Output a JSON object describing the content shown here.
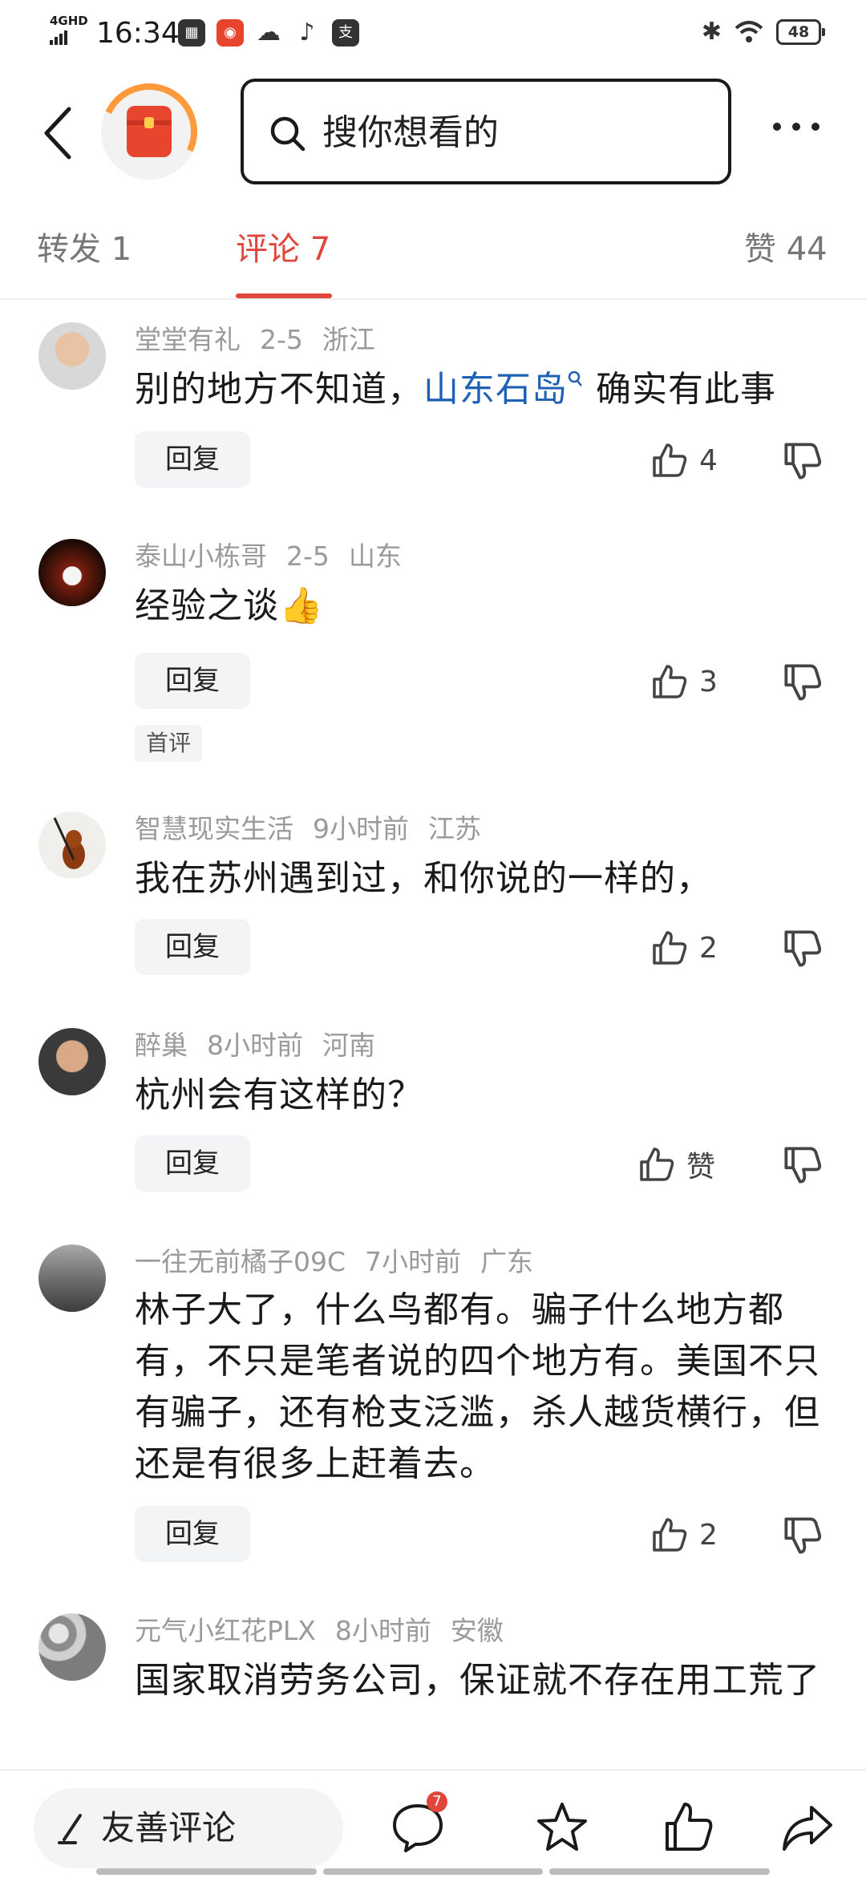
{
  "status_bar": {
    "network": "4GHD",
    "time": "16:34",
    "battery": "48"
  },
  "header": {
    "search_placeholder": "搜你想看的"
  },
  "tabs": [
    {
      "label": "转发 1"
    },
    {
      "label": "评论 7",
      "active": true
    },
    {
      "label": "赞 44"
    }
  ],
  "comments": [
    {
      "user": "堂堂有礼",
      "time": "2-5",
      "location": "浙江",
      "text_before": "别的地方不知道，",
      "link": "山东石岛",
      "text_after": "确实有此事",
      "reply": "回复",
      "likes": "4"
    },
    {
      "user": "泰山小栋哥",
      "time": "2-5",
      "location": "山东",
      "text": "经验之谈👍",
      "reply": "回复",
      "likes": "3",
      "badge": "首评"
    },
    {
      "user": "智慧现实生活",
      "time": "9小时前",
      "location": "江苏",
      "text": "我在苏州遇到过，和你说的一样的，",
      "reply": "回复",
      "likes": "2"
    },
    {
      "user": "醉巢",
      "time": "8小时前",
      "location": "河南",
      "text": "杭州会有这样的？",
      "reply": "回复",
      "likes": "赞"
    },
    {
      "user": "一往无前橘子09C",
      "time": "7小时前",
      "location": "广东",
      "text": "林子大了，什么鸟都有。骗子什么地方都有，不只是笔者说的四个地方有。美国不只有骗子，还有枪支泛滥，杀人越货横行，但还是有很多上赶着去。",
      "reply": "回复",
      "likes": "2"
    },
    {
      "user": "元气小红花PLX",
      "time": "8小时前",
      "location": "安徽",
      "text": "国家取消劳务公司，保证就不存在用工荒了"
    }
  ],
  "bottom_bar": {
    "comment_input_label": "友善评论",
    "comment_count_badge": "7"
  },
  "colors": {
    "accent": "#e0463b",
    "link": "#1f62b5",
    "meta": "#9a9a9a"
  }
}
